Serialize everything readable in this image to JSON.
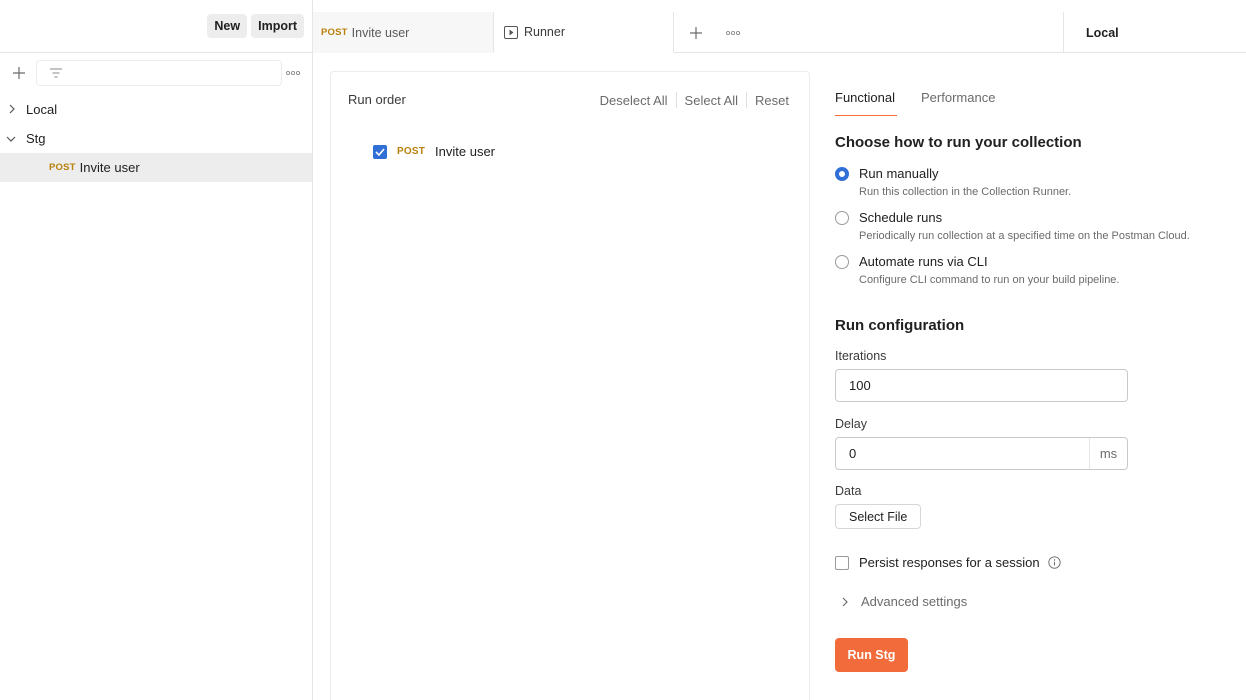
{
  "sidebar": {
    "new_label": "New",
    "import_label": "Import",
    "tree": [
      {
        "label": "Local",
        "expanded": false
      },
      {
        "label": "Stg",
        "expanded": true
      },
      {
        "method": "POST",
        "label": "Invite user"
      }
    ]
  },
  "tabs": [
    {
      "method": "POST",
      "label": "Invite user"
    },
    {
      "label": "Runner",
      "icon": "play-icon"
    }
  ],
  "environment": "Local",
  "run_order": {
    "title": "Run order",
    "deselect_all": "Deselect All",
    "select_all": "Select All",
    "reset": "Reset",
    "items": [
      {
        "method": "POST",
        "label": "Invite user",
        "checked": true
      }
    ]
  },
  "right": {
    "tab_functional": "Functional",
    "tab_performance": "Performance",
    "choose_title": "Choose how to run your collection",
    "options": [
      {
        "label": "Run manually",
        "desc": "Run this collection in the Collection Runner.",
        "selected": true
      },
      {
        "label": "Schedule runs",
        "desc": "Periodically run collection at a specified time on the Postman Cloud.",
        "selected": false
      },
      {
        "label": "Automate runs via CLI",
        "desc": "Configure CLI command to run on your build pipeline.",
        "selected": false
      }
    ],
    "config_title": "Run configuration",
    "iterations_label": "Iterations",
    "iterations_value": "100",
    "delay_label": "Delay",
    "delay_value": "0",
    "delay_unit": "ms",
    "data_label": "Data",
    "select_file": "Select File",
    "persist_label": "Persist responses for a session",
    "advanced": "Advanced settings",
    "run_button": "Run Stg"
  },
  "colors": {
    "accent": "#f26b3a",
    "checkbox": "#2f6fd6",
    "method_post": "#b9800c"
  }
}
